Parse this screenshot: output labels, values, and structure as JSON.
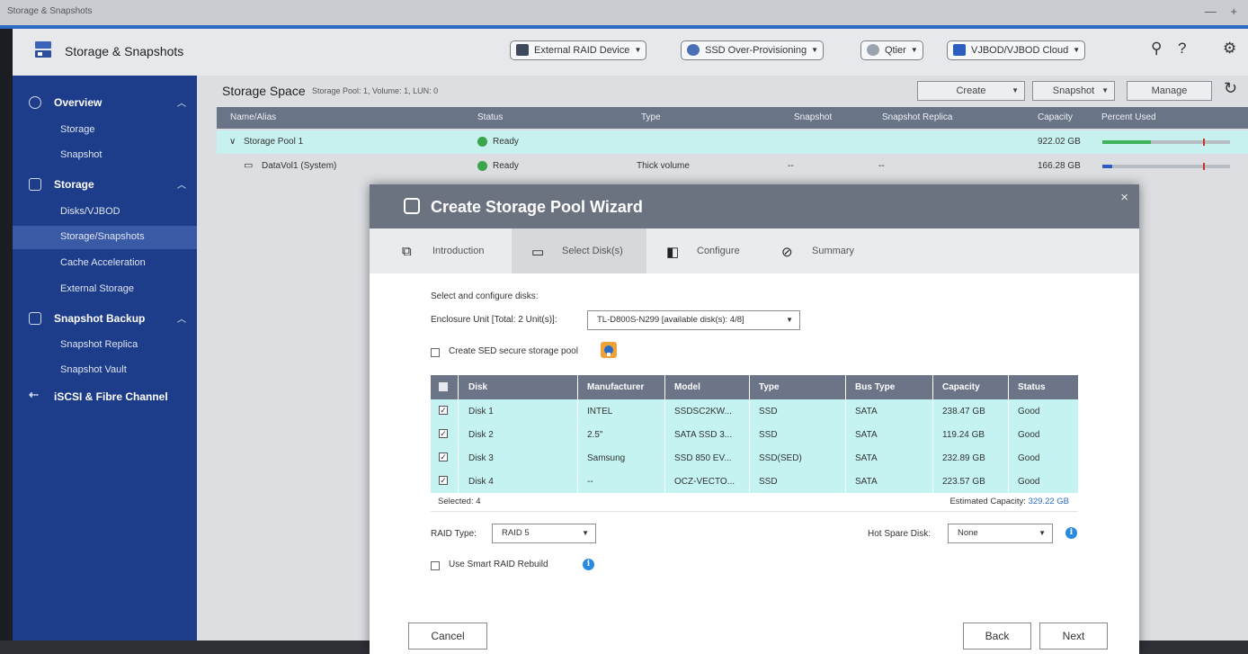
{
  "window": {
    "title": "Storage & Snapshots",
    "controls": "— +"
  },
  "header": {
    "app_title": "Storage & Snapshots",
    "buttons": {
      "external_raid": "External RAID Device",
      "ssd_overprov": "SSD Over-Provisioning",
      "qtier": "Qtier",
      "vjbod": "VJBOD/VJBOD Cloud"
    }
  },
  "sidebar": {
    "overview": {
      "label": "Overview",
      "items": [
        "Storage",
        "Snapshot"
      ]
    },
    "storage": {
      "label": "Storage",
      "items": [
        "Disks/VJBOD",
        "Storage/Snapshots",
        "Cache Acceleration",
        "External Storage"
      ]
    },
    "snapshot_backup": {
      "label": "Snapshot Backup",
      "items": [
        "Snapshot Replica",
        "Snapshot Vault"
      ]
    },
    "iscsi": {
      "label": "iSCSI & Fibre Channel"
    }
  },
  "main": {
    "title": "Storage Space",
    "subtitle": "Storage Pool: 1, Volume: 1, LUN: 0",
    "buttons": {
      "create": "Create",
      "snapshot": "Snapshot",
      "manage": "Manage"
    },
    "columns": [
      "Name/Alias",
      "Status",
      "Type",
      "Snapshot",
      "Snapshot Replica",
      "Capacity",
      "Percent Used"
    ],
    "rows": [
      {
        "name": "Storage Pool 1",
        "status": "Ready",
        "type": "",
        "snapshot": "",
        "replica": "",
        "capacity": "922.02 GB",
        "percent_used": 0.38
      },
      {
        "name": "DataVol1 (System)",
        "status": "Ready",
        "type": "Thick volume",
        "snapshot": "--",
        "replica": "--",
        "capacity": "166.28 GB",
        "percent_used": 0.08
      }
    ]
  },
  "wizard": {
    "title": "Create Storage Pool Wizard",
    "close": "×",
    "steps": [
      "Introduction",
      "Select Disk(s)",
      "Configure",
      "Summary"
    ],
    "select_label": "Select and configure disks:",
    "enclosure_label": "Enclosure Unit [Total: 2 Unit(s)]:",
    "enclosure_value": "TL-D800S-N299 [available disk(s): 4/8]",
    "sed_label": "Create SED secure storage pool",
    "disk_columns": [
      "Disk",
      "Manufacturer",
      "Model",
      "Type",
      "Bus Type",
      "Capacity",
      "Status"
    ],
    "disks": [
      {
        "disk": "Disk 1",
        "manufacturer": "INTEL",
        "model": "SSDSC2KW...",
        "type": "SSD",
        "bus": "SATA",
        "capacity": "238.47 GB",
        "status": "Good"
      },
      {
        "disk": "Disk 2",
        "manufacturer": "2.5\"",
        "model": "SATA SSD 3...",
        "type": "SSD",
        "bus": "SATA",
        "capacity": "119.24 GB",
        "status": "Good"
      },
      {
        "disk": "Disk 3",
        "manufacturer": "Samsung",
        "model": "SSD 850 EV...",
        "type": "SSD(SED)",
        "bus": "SATA",
        "capacity": "232.89 GB",
        "status": "Good"
      },
      {
        "disk": "Disk 4",
        "manufacturer": "--",
        "model": "OCZ-VECTO...",
        "type": "SSD",
        "bus": "SATA",
        "capacity": "223.57 GB",
        "status": "Good"
      }
    ],
    "selected": "Selected: 4",
    "estimated_label": "Estimated Capacity:",
    "estimated_value": "329.22 GB",
    "raid_label": "RAID Type:",
    "raid_value": "RAID 5",
    "hot_spare_label": "Hot Spare Disk:",
    "hot_spare_value": "None",
    "smart_rebuild_label": "Use Smart RAID Rebuild",
    "buttons": {
      "cancel": "Cancel",
      "back": "Back",
      "next": "Next"
    }
  },
  "colors": {
    "sidebar": "#1d3c8a",
    "accent": "#2b6cc4",
    "ready": "#3aa54a",
    "selected_row": "#c4f3f2",
    "modal_header": "#6b7280"
  }
}
